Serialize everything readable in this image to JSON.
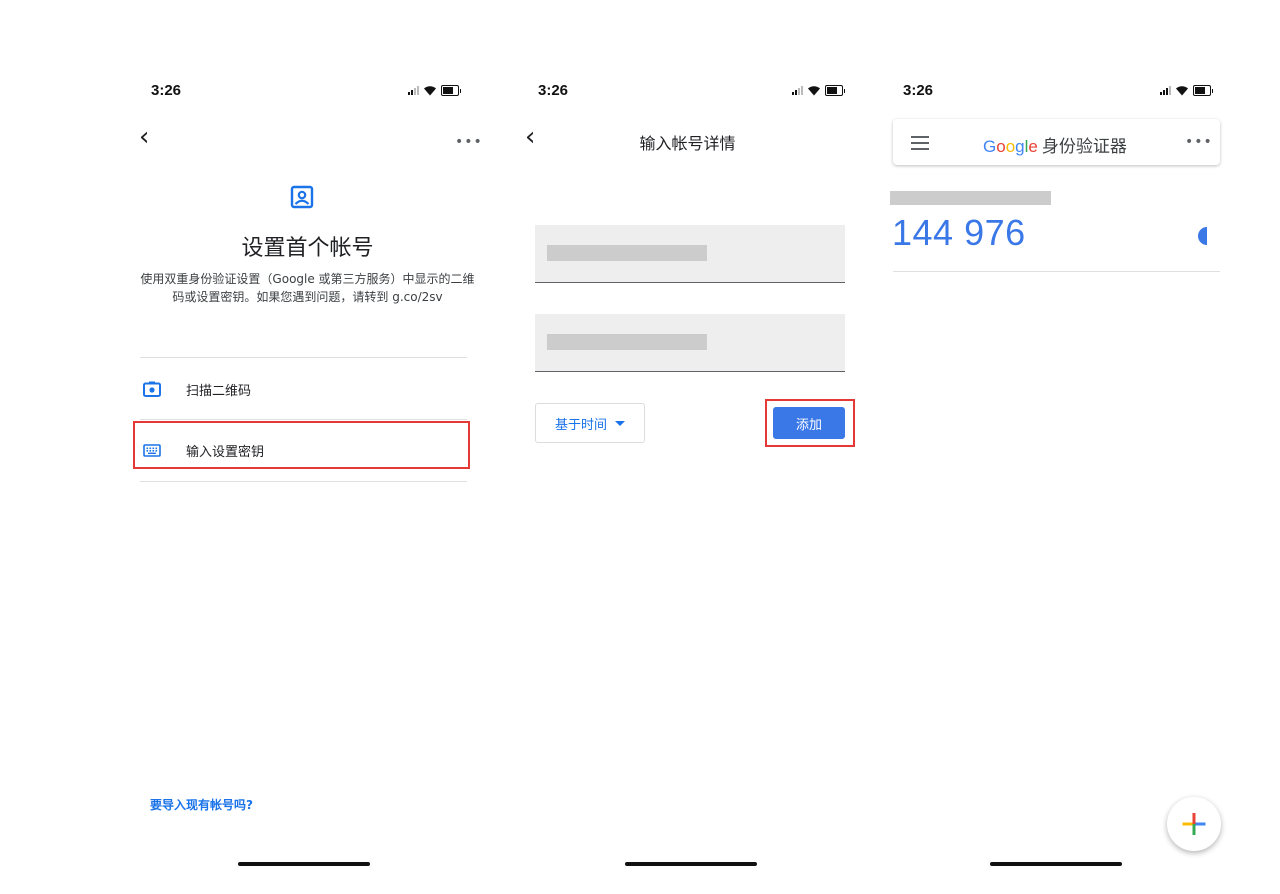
{
  "status_time": "3:26",
  "screen1": {
    "title": "设置首个帐号",
    "description": "使用双重身份验证设置（Google 或第三方服务）中显示的二维码或设置密钥。如果您遇到问题，请转到 g.co/2sv",
    "options": [
      {
        "label": "扫描二维码",
        "icon": "camera-icon"
      },
      {
        "label": "输入设置密钥",
        "icon": "keyboard-icon"
      }
    ],
    "import_link": "要导入现有帐号吗?"
  },
  "screen2": {
    "title": "输入帐号详情",
    "dropdown_label": "基于时间",
    "add_button": "添加"
  },
  "screen3": {
    "app_title": "身份验证器",
    "brand": [
      "G",
      "o",
      "o",
      "g",
      "l",
      "e"
    ],
    "brand_colors": [
      "#4285F4",
      "#EA4335",
      "#FBBC05",
      "#4285F4",
      "#34A853",
      "#EA4335"
    ],
    "code": "144 976",
    "accent_color": "#3b78e7"
  },
  "colors": {
    "link": "#1a73e8",
    "highlight_border": "#e53935",
    "button": "#3b78e7"
  }
}
